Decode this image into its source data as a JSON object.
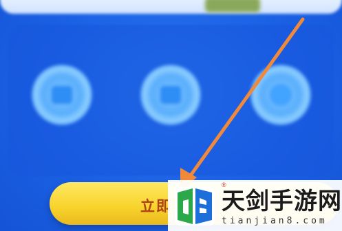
{
  "section": {
    "title": ""
  },
  "features": [
    {
      "caption": "",
      "sub": ""
    },
    {
      "caption": "",
      "sub": ""
    },
    {
      "caption": "",
      "sub": ""
    }
  ],
  "cta": {
    "label": "立即"
  },
  "watermark": {
    "brand": "天剑手游网",
    "url": "tianjian8.com",
    "mark": "®"
  },
  "colors": {
    "background": "#1a62e6",
    "cta_yellow": "#f7d32a",
    "cta_text": "#b0421a",
    "arrow": "#f08a3a",
    "logo_green": "#2aa84a",
    "logo_blue": "#1c6fd8"
  },
  "icons": [
    "feature-1-icon",
    "feature-2-icon",
    "feature-3-icon",
    "annotation-arrow-icon",
    "brand-logo-icon"
  ]
}
